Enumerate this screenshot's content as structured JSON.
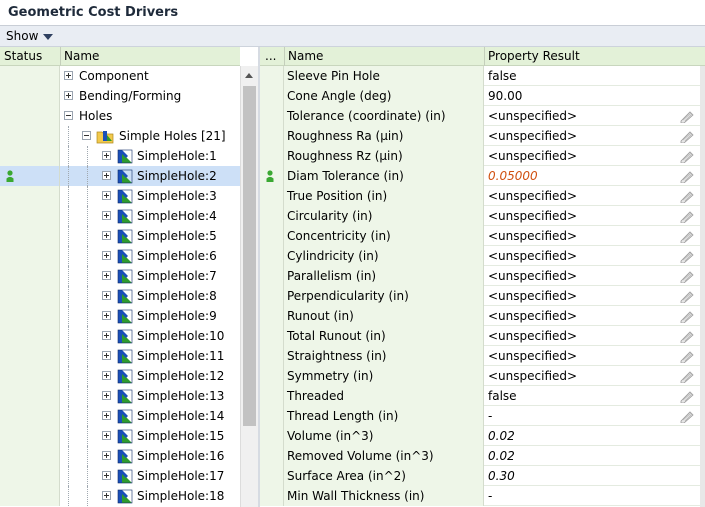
{
  "title": "Geometric Cost Drivers",
  "toolbar": {
    "show_label": "Show"
  },
  "left": {
    "headers": {
      "status": "Status",
      "name": "Name"
    },
    "tree": [
      {
        "label": "Component",
        "expander": "plus",
        "level": 0
      },
      {
        "label": "Bending/Forming",
        "expander": "plus",
        "level": 0
      },
      {
        "label": "Holes",
        "expander": "minus",
        "level": 0
      },
      {
        "label": "Simple Holes [21]",
        "expander": "minus",
        "level": 1,
        "icon": "folder"
      },
      {
        "label": "SimpleHole:1",
        "expander": "plus",
        "level": 2,
        "icon": "hole"
      },
      {
        "label": "SimpleHole:2",
        "expander": "plus",
        "level": 2,
        "icon": "hole",
        "selected": true,
        "status": "ok"
      },
      {
        "label": "SimpleHole:3",
        "expander": "plus",
        "level": 2,
        "icon": "hole"
      },
      {
        "label": "SimpleHole:4",
        "expander": "plus",
        "level": 2,
        "icon": "hole"
      },
      {
        "label": "SimpleHole:5",
        "expander": "plus",
        "level": 2,
        "icon": "hole"
      },
      {
        "label": "SimpleHole:6",
        "expander": "plus",
        "level": 2,
        "icon": "hole"
      },
      {
        "label": "SimpleHole:7",
        "expander": "plus",
        "level": 2,
        "icon": "hole"
      },
      {
        "label": "SimpleHole:8",
        "expander": "plus",
        "level": 2,
        "icon": "hole"
      },
      {
        "label": "SimpleHole:9",
        "expander": "plus",
        "level": 2,
        "icon": "hole"
      },
      {
        "label": "SimpleHole:10",
        "expander": "plus",
        "level": 2,
        "icon": "hole"
      },
      {
        "label": "SimpleHole:11",
        "expander": "plus",
        "level": 2,
        "icon": "hole"
      },
      {
        "label": "SimpleHole:12",
        "expander": "plus",
        "level": 2,
        "icon": "hole"
      },
      {
        "label": "SimpleHole:13",
        "expander": "plus",
        "level": 2,
        "icon": "hole"
      },
      {
        "label": "SimpleHole:14",
        "expander": "plus",
        "level": 2,
        "icon": "hole"
      },
      {
        "label": "SimpleHole:15",
        "expander": "plus",
        "level": 2,
        "icon": "hole"
      },
      {
        "label": "SimpleHole:16",
        "expander": "plus",
        "level": 2,
        "icon": "hole"
      },
      {
        "label": "SimpleHole:17",
        "expander": "plus",
        "level": 2,
        "icon": "hole"
      },
      {
        "label": "SimpleHole:18",
        "expander": "plus",
        "level": 2,
        "icon": "hole"
      }
    ]
  },
  "right": {
    "headers": {
      "gutter": "...",
      "name": "Name",
      "result": "Property Result"
    },
    "rows": [
      {
        "name": "Sleeve Pin Hole",
        "value": "false",
        "style": "normal",
        "editable": false
      },
      {
        "name": "Cone Angle (deg)",
        "value": "90.00",
        "style": "normal",
        "editable": false
      },
      {
        "name": "Tolerance (coordinate) (in)",
        "value": "<unspecified>",
        "style": "normal",
        "editable": true
      },
      {
        "name": "Roughness Ra (µin)",
        "value": "<unspecified>",
        "style": "normal",
        "editable": true
      },
      {
        "name": "Roughness Rz (µin)",
        "value": "<unspecified>",
        "style": "normal",
        "editable": true
      },
      {
        "name": "Diam Tolerance (in)",
        "value": "0.05000",
        "style": "orange",
        "editable": true,
        "status": "ok"
      },
      {
        "name": "True Position (in)",
        "value": "<unspecified>",
        "style": "normal",
        "editable": true
      },
      {
        "name": "Circularity (in)",
        "value": "<unspecified>",
        "style": "normal",
        "editable": true
      },
      {
        "name": "Concentricity (in)",
        "value": "<unspecified>",
        "style": "normal",
        "editable": true
      },
      {
        "name": "Cylindricity (in)",
        "value": "<unspecified>",
        "style": "normal",
        "editable": true
      },
      {
        "name": "Parallelism (in)",
        "value": "<unspecified>",
        "style": "normal",
        "editable": true
      },
      {
        "name": "Perpendicularity (in)",
        "value": "<unspecified>",
        "style": "normal",
        "editable": true
      },
      {
        "name": "Runout (in)",
        "value": "<unspecified>",
        "style": "normal",
        "editable": true
      },
      {
        "name": "Total Runout (in)",
        "value": "<unspecified>",
        "style": "normal",
        "editable": true
      },
      {
        "name": "Straightness (in)",
        "value": "<unspecified>",
        "style": "normal",
        "editable": true
      },
      {
        "name": "Symmetry (in)",
        "value": "<unspecified>",
        "style": "normal",
        "editable": true
      },
      {
        "name": "Threaded",
        "value": "false",
        "style": "normal",
        "editable": true
      },
      {
        "name": "Thread Length (in)",
        "value": "-",
        "style": "normal",
        "editable": true
      },
      {
        "name": "Volume (in^3)",
        "value": "0.02",
        "style": "italic",
        "editable": false
      },
      {
        "name": "Removed Volume (in^3)",
        "value": "0.02",
        "style": "italic",
        "editable": false
      },
      {
        "name": "Surface Area (in^2)",
        "value": "0.30",
        "style": "italic",
        "editable": false
      },
      {
        "name": "Min Wall Thickness (in)",
        "value": "-",
        "style": "normal",
        "editable": false
      }
    ]
  },
  "colors": {
    "header_bg": "#e3f1d8",
    "selection": "#cde0f7",
    "status_ok": "#3aa832",
    "orange_value": "#d05010",
    "hole_icon_blue": "#1a4fb8",
    "hole_icon_green": "#2e9a2e",
    "folder_yellow": "#f2c94c"
  },
  "icons": {
    "status": "green-person-icon",
    "hole": "simple-hole-icon",
    "folder": "hole-group-folder-icon",
    "edit": "pencil-edit-icon"
  }
}
